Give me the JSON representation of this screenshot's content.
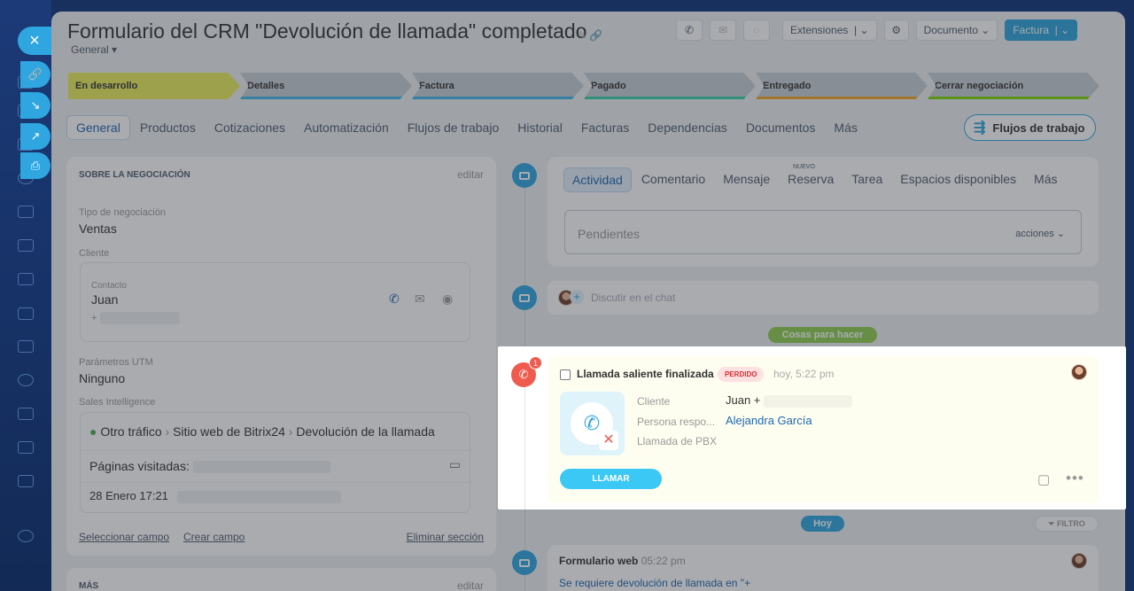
{
  "header": {
    "title": "Formulario del CRM \"Devolución de llamada\" completado",
    "subtitle": "General",
    "badge_new": "NUEVO",
    "extensions": "Extensiones",
    "document": "Documento",
    "invoice": "Factura"
  },
  "stages": [
    {
      "label": "En desarrollo",
      "color": "#ecee5b"
    },
    {
      "label": "Detalles",
      "color": "#3cb6ea"
    },
    {
      "label": "Factura",
      "color": "#3cb6ea"
    },
    {
      "label": "Pagado",
      "color": "#38d3a6"
    },
    {
      "label": "Entregado",
      "color": "#f5a623"
    },
    {
      "label": "Cerrar negociación",
      "color": "#7bd500"
    }
  ],
  "tabs": [
    "General",
    "Productos",
    "Cotizaciones",
    "Automatización",
    "Flujos de trabajo",
    "Historial",
    "Facturas",
    "Dependencias",
    "Documentos",
    "Más"
  ],
  "workflows_button": "Flujos de trabajo",
  "about": {
    "heading": "SOBRE LA NEGOCIACIÓN",
    "edit": "editar",
    "type_label": "Tipo de negociación",
    "type_value": "Ventas",
    "client_label": "Cliente",
    "contact_label": "Contacto",
    "contact_name": "Juan",
    "contact_phone_prefix": "+",
    "utm_label": "Parámetros UTM",
    "utm_value": "Ninguno",
    "si_label": "Sales Intelligence",
    "source": "Otro tráfico",
    "site": "Sitio web de Bitrix24",
    "form": "Devolución de la llamada",
    "pages_label": "Páginas visitadas:",
    "date": "28 Enero 17:21",
    "select_field": "Seleccionar campo",
    "create_field": "Crear campo",
    "delete_section": "Eliminar sección",
    "more_heading": "MÁS",
    "more_edit": "editar"
  },
  "activity": {
    "tabs": [
      "Actividad",
      "Comentario",
      "Mensaje",
      "Reserva",
      "Tarea",
      "Espacios disponibles",
      "Más"
    ],
    "new_badge": "NUEVO",
    "pending_placeholder": "Pendientes",
    "actions": "acciones",
    "chat_placeholder": "Discutir en el chat",
    "todo_pill": "Cosas para hacer"
  },
  "call": {
    "badge": "1",
    "title": "Llamada saliente finalizada",
    "status": "PERDIDO",
    "time": "hoy, 5:22 pm",
    "client_label": "Cliente",
    "client_value": "Juan +",
    "resp_label": "Persona respo...",
    "resp_value": "Alejandra García",
    "pbx_label": "Llamada de PBX",
    "call_button": "LLAMAR"
  },
  "today_pill": "Hoy",
  "filter": "FILTRO",
  "webform": {
    "title": "Formulario web",
    "time": "05:22 pm",
    "text": "Se requiere devolución de llamada en \"+"
  }
}
